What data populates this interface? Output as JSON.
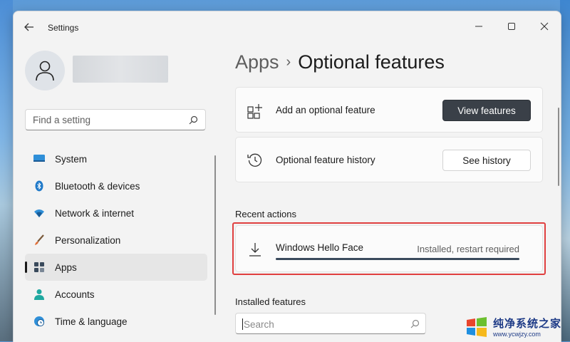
{
  "window": {
    "title": "Settings"
  },
  "sidebar": {
    "search_placeholder": "Find a setting",
    "items": [
      {
        "label": "System",
        "icon": "monitor-icon"
      },
      {
        "label": "Bluetooth & devices",
        "icon": "bluetooth-icon"
      },
      {
        "label": "Network & internet",
        "icon": "wifi-icon"
      },
      {
        "label": "Personalization",
        "icon": "brush-icon"
      },
      {
        "label": "Apps",
        "icon": "apps-icon",
        "selected": true
      },
      {
        "label": "Accounts",
        "icon": "person-icon"
      },
      {
        "label": "Time & language",
        "icon": "globe-clock-icon"
      }
    ]
  },
  "main": {
    "breadcrumb": {
      "parent": "Apps",
      "separator": "›",
      "current": "Optional features"
    },
    "add_card": {
      "label": "Add an optional feature",
      "button": "View features"
    },
    "history_card": {
      "label": "Optional feature history",
      "button": "See history"
    },
    "recent": {
      "heading": "Recent actions",
      "item": {
        "name": "Windows Hello Face",
        "status": "Installed, restart required",
        "progress": 1.0
      }
    },
    "installed": {
      "heading": "Installed features",
      "search_placeholder": "Search"
    }
  },
  "watermark": {
    "line1": "纯净系统之家",
    "line2": "www.ycwjzy.com"
  },
  "colors": {
    "accent_button": "#3a4048",
    "highlight_border": "#e04040",
    "selected_nav": "#e6e6e6"
  }
}
